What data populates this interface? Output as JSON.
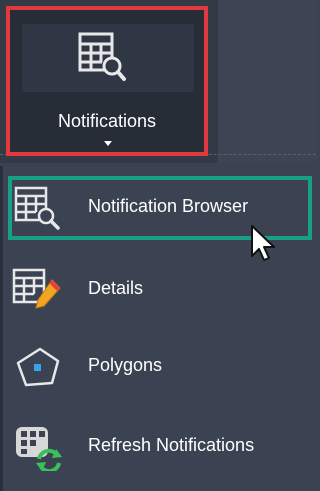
{
  "ribbon": {
    "button_label": "Notifications",
    "button_icon": "notification-browser-icon",
    "dropdown_indicator": "caret-down-icon",
    "highlight_color": "#e0393e"
  },
  "menu": {
    "highlight_color": "#17a085",
    "items": [
      {
        "label": "Notification Browser",
        "icon": "notification-browser-icon",
        "active": true
      },
      {
        "label": "Details",
        "icon": "details-edit-icon",
        "active": false
      },
      {
        "label": "Polygons",
        "icon": "polygon-icon",
        "active": false
      },
      {
        "label": "Refresh Notifications",
        "icon": "refresh-notifications-icon",
        "active": false
      }
    ]
  }
}
